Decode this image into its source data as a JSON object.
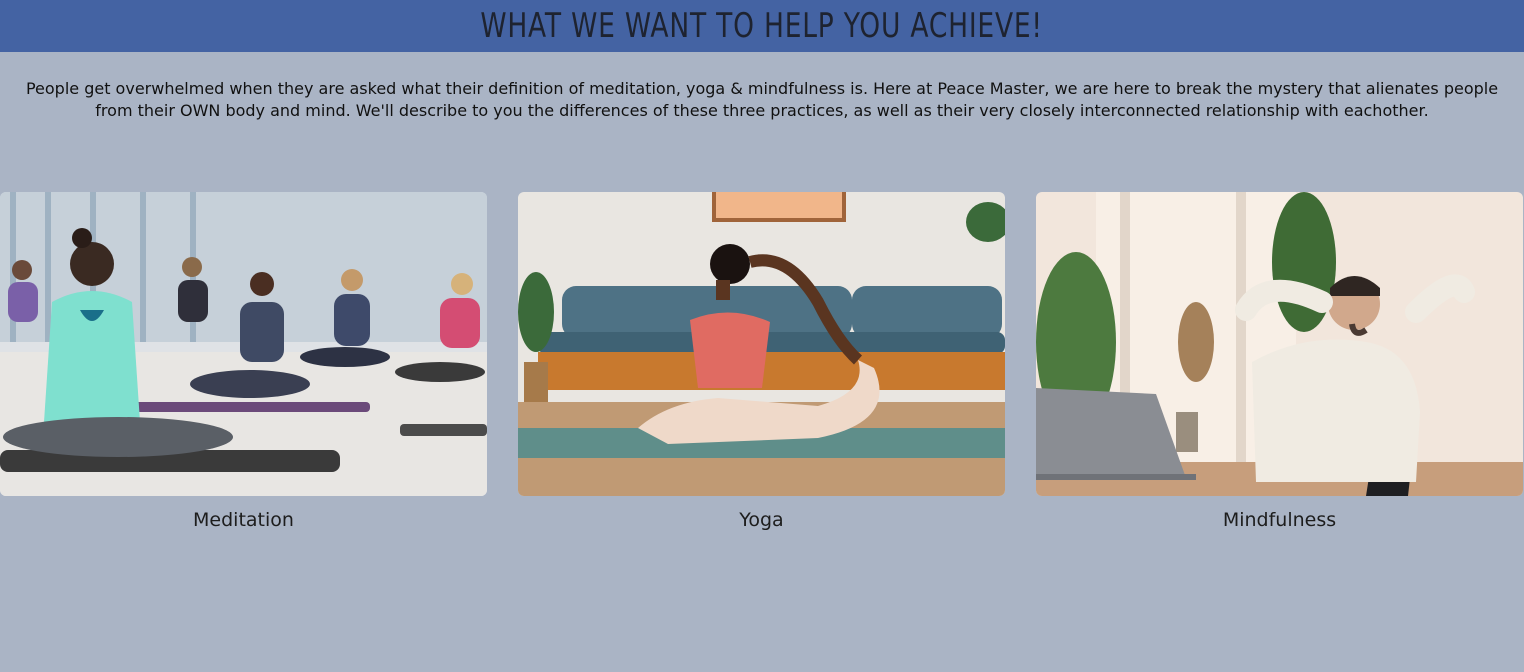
{
  "header": {
    "title": "WHAT WE WANT TO HELP YOU ACHIEVE!"
  },
  "intro": {
    "text": "People get overwhelmed when they are asked what their definition of meditation, yoga & mindfulness is. Here at Peace Master, we are here to break the mystery that alienates people from their OWN body and mind. We'll describe to you the differences of these three practices, as well as their very closely interconnected relationship with eachother."
  },
  "cards": [
    {
      "label": "Meditation",
      "image_alt": "group meditation class"
    },
    {
      "label": "Yoga",
      "image_alt": "woman in yoga pose"
    },
    {
      "label": "Mindfulness",
      "image_alt": "man relaxing at desk"
    }
  ],
  "colors": {
    "background": "#aab4c5",
    "banner": "#4463a3",
    "title_text": "#1e2330"
  }
}
